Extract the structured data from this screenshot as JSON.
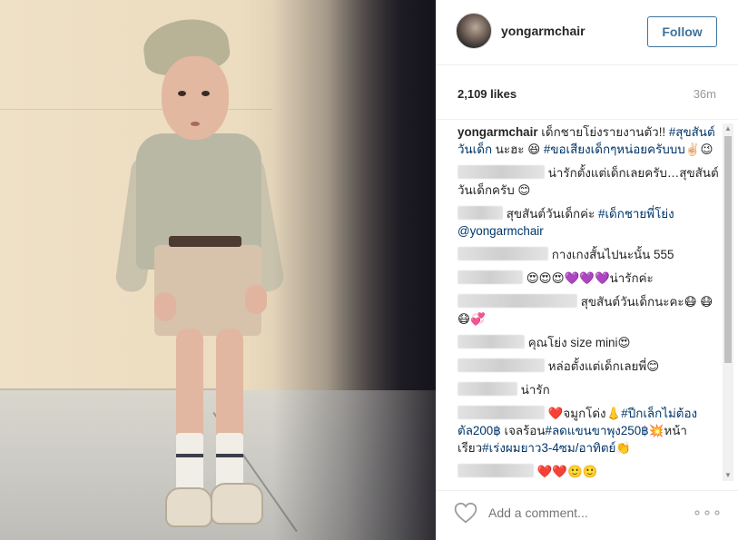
{
  "post": {
    "username": "yongarmchair",
    "follow_label": "Follow",
    "likes": "2,109 likes",
    "age": "36m"
  },
  "comments": [
    {
      "user": "yongarmchair",
      "segments": [
        {
          "text": "เด็กชายโย่งรายงานตัว!! "
        },
        {
          "text": "#สุขสันต์วันเด็ก",
          "tag": true
        },
        {
          "text": " นะฮะ 😆 "
        },
        {
          "text": "#ขอเสียงเด็กๆหน่อยครับบบ",
          "tag": true
        },
        {
          "text": "✌🏻😉"
        }
      ]
    },
    {
      "blur": 96,
      "segments": [
        {
          "text": " น่ารักตั้งแต่เด็กเลยครับ…สุขสันต์วันเด็กครับ 😊"
        }
      ]
    },
    {
      "blur": 50,
      "segments": [
        {
          "text": " สุขสันต์วันเด็กค่ะ "
        },
        {
          "text": "#เด็กชายพี่โย่ง",
          "tag": true
        },
        {
          "text": " "
        },
        {
          "text": "@yongarmchair",
          "tag": true
        }
      ]
    },
    {
      "blur": 100,
      "segments": [
        {
          "text": " กางเกงสั้นไปนะนั้น 555"
        }
      ]
    },
    {
      "blur": 72,
      "segments": [
        {
          "text": " 😍😍😍💜💜💜น่ารักค่ะ"
        }
      ]
    },
    {
      "blur": 132,
      "segments": [
        {
          "text": " สุขสันต์วันเด็กนะคะ😷 😷😷💞"
        }
      ]
    },
    {
      "blur": 74,
      "segments": [
        {
          "text": " คุณโย่ง size mini😍"
        }
      ]
    },
    {
      "blur": 96,
      "segments": [
        {
          "text": " หล่อตั้งแต่เด็กเลยพี่😊"
        }
      ]
    },
    {
      "blur": 66,
      "segments": [
        {
          "text": " น่ารัก"
        }
      ]
    },
    {
      "blur": 96,
      "segments": [
        {
          "text": " ❤️จมูกโด่ง👃"
        },
        {
          "text": "#ปีกเล็กไม่ต้องตัล200฿",
          "tag": true
        },
        {
          "text": " เจลร้อน"
        },
        {
          "text": "#ลดแขนขาพุง250฿",
          "tag": true
        },
        {
          "text": "💥หน้าเรียว"
        },
        {
          "text": "#เร่งผมยาว3-4ซม/อาทิตย์",
          "tag": true
        },
        {
          "text": "👏"
        }
      ]
    },
    {
      "blur": 84,
      "segments": [
        {
          "text": " ❤️❤️🙂🙂"
        }
      ]
    }
  ],
  "footer": {
    "comment_placeholder": "Add a comment...",
    "more_label": "∘∘∘"
  },
  "icons": {
    "heart": "heart-outline-icon",
    "more": "more-options-icon"
  },
  "colors": {
    "accent": "#3f729b",
    "hashtag": "#003569"
  }
}
